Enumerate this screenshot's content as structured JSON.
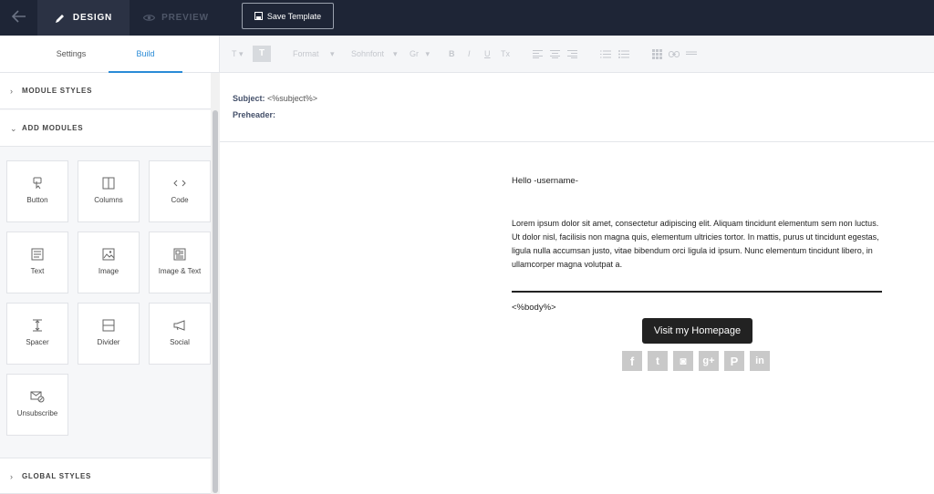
{
  "topbar": {
    "design_label": "DESIGN",
    "preview_label": "PREVIEW",
    "save_label": "Save Template"
  },
  "sidebar": {
    "tabs": [
      {
        "label": "Settings"
      },
      {
        "label": "Build"
      }
    ],
    "sections": {
      "module_styles": "MODULE STYLES",
      "add_modules": "ADD MODULES",
      "global_styles": "GLOBAL STYLES"
    },
    "modules": [
      {
        "label": "Button",
        "icon": "button-icon"
      },
      {
        "label": "Columns",
        "icon": "columns-icon"
      },
      {
        "label": "Code",
        "icon": "code-icon"
      },
      {
        "label": "Text",
        "icon": "text-icon"
      },
      {
        "label": "Image",
        "icon": "image-icon"
      },
      {
        "label": "Image & Text",
        "icon": "image-text-icon"
      },
      {
        "label": "Spacer",
        "icon": "spacer-icon"
      },
      {
        "label": "Divider",
        "icon": "divider-icon"
      },
      {
        "label": "Social",
        "icon": "megaphone-icon"
      },
      {
        "label": "Unsubscribe",
        "icon": "unsubscribe-icon"
      }
    ]
  },
  "toolbar": {
    "text_style": "T",
    "text_color": "T",
    "format": "Format",
    "font_family": "Sohnfont",
    "font_size": "Gr",
    "bold": "B",
    "italic": "I",
    "underline": "U",
    "clear_format": "Tx"
  },
  "headers": {
    "subject_label": "Subject:",
    "subject_value": "<%subject%>",
    "preheader_label": "Preheader:"
  },
  "email": {
    "greeting": "Hello -username-",
    "paragraph": "Lorem ipsum dolor sit amet, consectetur adipiscing elit. Aliquam tincidunt elementum sem non luctus. Ut dolor nisl, facilisis non magna quis, elementum ultricies tortor. In mattis, purus ut tincidunt egestas, ligula nulla accumsan justo, vitae bibendum orci ligula id ipsum. Nunc elementum tincidunt libero, in ullamcorper magna volutpat a.",
    "body_tag": "<%body%>",
    "button_label": "Visit my Homepage",
    "social_icons": [
      "facebook-icon",
      "twitter-icon",
      "instagram-icon",
      "google-plus-icon",
      "pinterest-icon",
      "linkedin-icon"
    ],
    "social_glyphs": [
      "f",
      "t",
      "◙",
      "g+",
      "P",
      "in"
    ]
  },
  "colors": {
    "topbar_bg": "#1e2536",
    "accent": "#2a8bd6",
    "button_bg": "#222222",
    "social_bg": "#c9c9c9"
  }
}
